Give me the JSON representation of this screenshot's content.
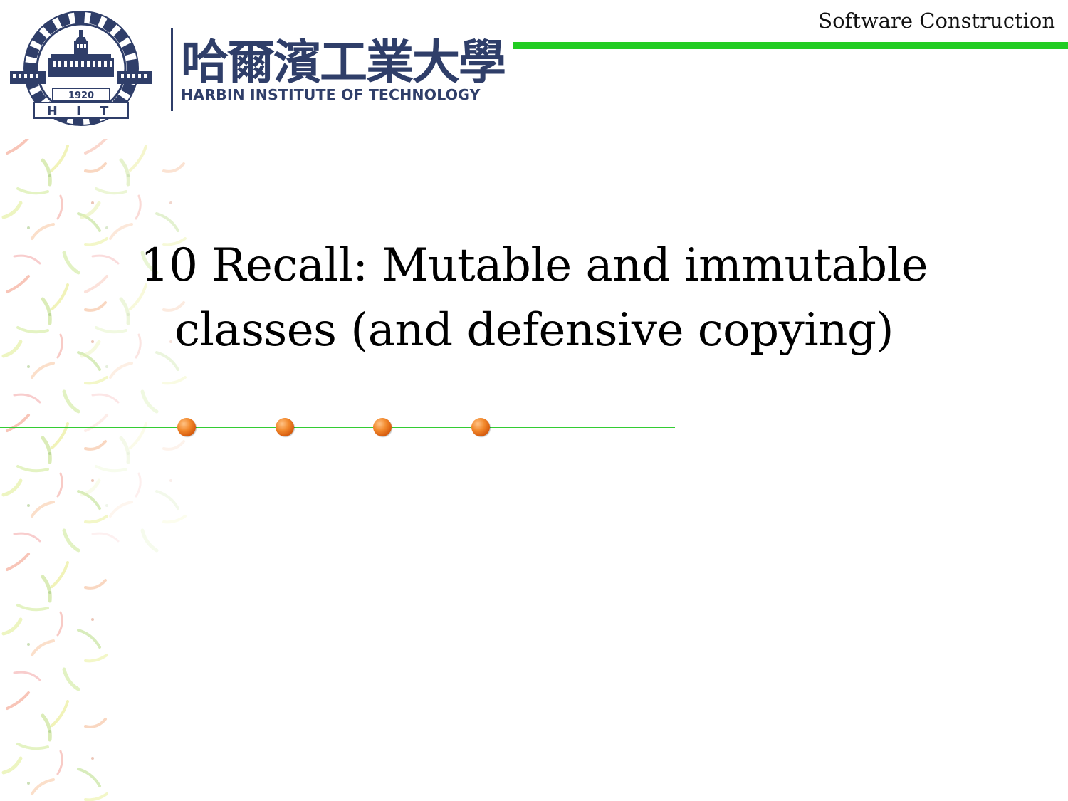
{
  "header": {
    "course_name": "Software Construction",
    "institution_cn": "哈爾濱工業大學",
    "institution_en": "HARBIN INSTITUTE OF TECHNOLOGY",
    "logo": {
      "year": "1920",
      "letters": "H I T",
      "icon": "hit-emblem-icon"
    },
    "accent_color": "#22cc22",
    "brand_color": "#2f3e69"
  },
  "slide": {
    "title_line1": "10 Recall: Mutable and immutable",
    "title_line2": "classes (and defensive copying)"
  },
  "decoration": {
    "dot_color": "#f28a2e",
    "line_color": "#33cc33",
    "dot_count": 4
  }
}
